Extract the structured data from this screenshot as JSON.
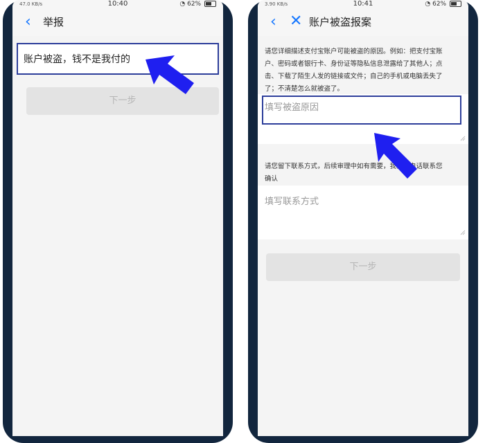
{
  "left_screen": {
    "status": {
      "time": "10:40",
      "battery": "62%",
      "speed": "47.0 KB/s"
    },
    "nav": {
      "back_icon": "chevron-left-icon",
      "title": "举报"
    },
    "option_selected": "账户被盗，钱不是我付的",
    "next_button": "下一步"
  },
  "right_screen": {
    "status": {
      "time": "10:41",
      "battery": "62%",
      "speed": "3.90 KB/s"
    },
    "nav": {
      "back_icon": "chevron-left-icon",
      "close_icon": "close-icon",
      "title": "账户被盗报案"
    },
    "reason_hint": {
      "line1": "请您详细描述支付宝账户可能被盗的原因。例如：把支付宝账",
      "line2": "户、密码或者银行卡、身份证等隐私信息泄露给了其他人；点",
      "line3": "击、下载了陌生人发的链接或文件；自己的手机或电脑丢失了",
      "line4": "了；不清楚怎么就被盗了。"
    },
    "reason_placeholder": "填写被盗原因",
    "contact_hint": {
      "line1": "请您留下联系方式，后续审理中如有需要，我们会电话联系您",
      "line2": "确认"
    },
    "contact_placeholder": "填写联系方式",
    "next_button": "下一步"
  },
  "colors": {
    "accent": "#1677ff",
    "highlight_border": "#2c3d9a",
    "arrow": "#1f1ff0"
  }
}
